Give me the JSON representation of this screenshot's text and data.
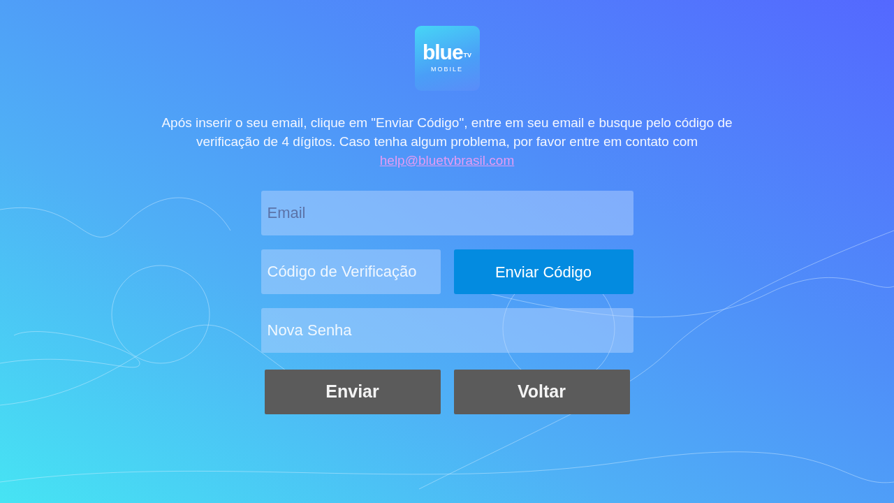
{
  "logo": {
    "brand": "blue",
    "badge": "TV",
    "subtitle": "MOBILE"
  },
  "instructions": {
    "text": "Após inserir o seu email, clique em \"Enviar Código\", entre em seu email e busque pelo código de verificação de 4 dígitos. Caso tenha algum problema, por favor entre em contato com",
    "link": "help@bluetvbrasil.com"
  },
  "email_field": {
    "placeholder": "Email"
  },
  "code_field": {
    "placeholder": "Código de Verificação"
  },
  "send_code_button": "Enviar Código",
  "password_field": {
    "placeholder": "Nova Senha"
  },
  "buttons": [
    "Enviar",
    "Voltar"
  ]
}
